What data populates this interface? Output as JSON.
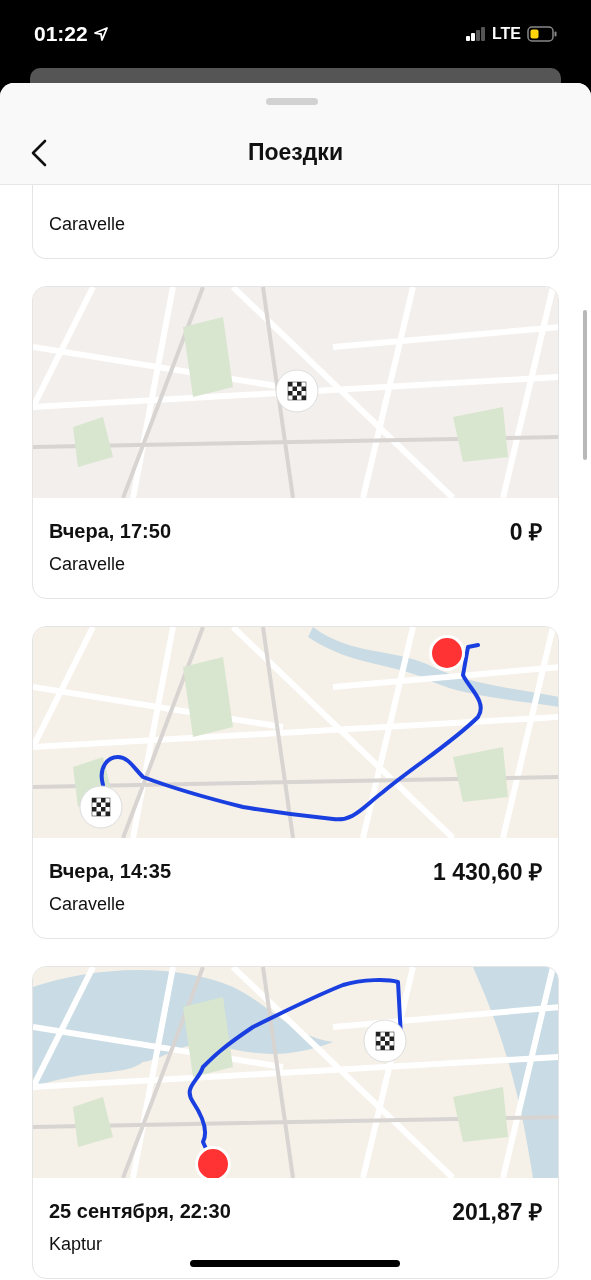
{
  "status_bar": {
    "time": "01:22",
    "network": "LTE"
  },
  "header": {
    "title": "Поездки"
  },
  "trips": [
    {
      "vehicle": "Caravelle"
    },
    {
      "map": {
        "markers": [
          {
            "kind": "finish"
          }
        ]
      },
      "date": "Вчера, 17:50",
      "price": "0 ₽",
      "vehicle": "Caravelle"
    },
    {
      "map": {
        "markers": [
          {
            "kind": "start"
          },
          {
            "kind": "finish"
          }
        ]
      },
      "date": "Вчера, 14:35",
      "price": "1 430,60 ₽",
      "vehicle": "Caravelle"
    },
    {
      "map": {
        "markers": [
          {
            "kind": "finish"
          },
          {
            "kind": "start"
          }
        ]
      },
      "date": "25 сентября, 22:30",
      "price": "201,87 ₽",
      "vehicle": "Kaptur"
    }
  ]
}
